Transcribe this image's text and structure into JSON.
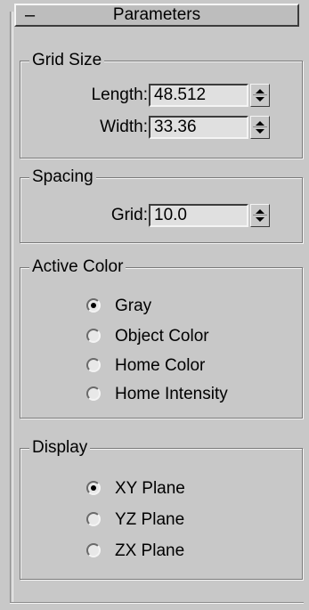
{
  "rollout": {
    "title": "Parameters",
    "toggle_symbol": "–"
  },
  "grid_size": {
    "label": "Grid Size",
    "length_label": "Length:",
    "length_value": "48.512",
    "width_label": "Width:",
    "width_value": "33.36"
  },
  "spacing": {
    "label": "Spacing",
    "grid_label": "Grid:",
    "grid_value": "10.0"
  },
  "active_color": {
    "label": "Active Color",
    "options": [
      {
        "label": "Gray",
        "selected": true
      },
      {
        "label": "Object Color",
        "selected": false
      },
      {
        "label": "Home Color",
        "selected": false
      },
      {
        "label": "Home Intensity",
        "selected": false
      }
    ]
  },
  "display": {
    "label": "Display",
    "options": [
      {
        "label": "XY Plane",
        "selected": true
      },
      {
        "label": "YZ Plane",
        "selected": false
      },
      {
        "label": "ZX Plane",
        "selected": false
      }
    ]
  },
  "icons": {
    "spinner": "up-down-spinner-icon",
    "radio_selected": "radio-selected-icon",
    "radio_unselected": "radio-unselected-icon"
  }
}
